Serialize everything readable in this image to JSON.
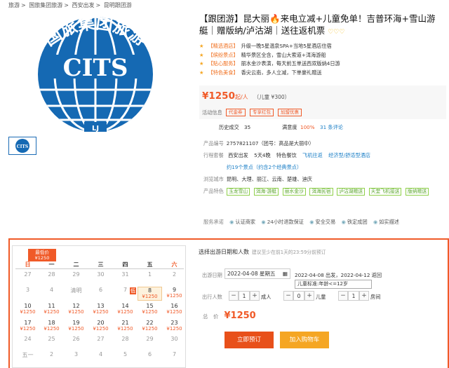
{
  "breadcrumb": [
    "旅游",
    "国旅集团旅游",
    "西安出发",
    "昆明跟团游"
  ],
  "logo": {
    "text_top": "国旅集团旅游",
    "text_center": "CITS",
    "text_bottom": "LJ"
  },
  "product": {
    "title": "【跟团游】昆大丽🔥来电立减+儿童免单！吉普环海+雪山游艇｜赠版纳/泸沽湖｜送往返机票",
    "hearts": "♡♡♡"
  },
  "features": [
    {
      "tag": "【精选酒店】",
      "text": "升级一晚5星温泉SPA+当地5星酒店住宿"
    },
    {
      "tag": "【缤纷景点】",
      "text": "精华景区全含，雪山大索道+洱海游船"
    },
    {
      "tag": "【贴心服务】",
      "text": "丽水金沙表演，每天前五单送西双版纳4日游"
    },
    {
      "tag": "【特色美食】",
      "text": "香尖云南，多人立减，下单豪礼赠送"
    }
  ],
  "price": {
    "amount": "¥1250",
    "unit": "起/人",
    "child": "（儿童 ¥300）",
    "promo_label": "活动信息",
    "promos": [
      "代金券",
      "专享红包",
      "加盟优惠"
    ]
  },
  "stats": {
    "sold_label": "历史成交",
    "sold_value": "35",
    "satisfaction_label": "满意度",
    "satisfaction_value": "100%",
    "reviews": "31 条评论"
  },
  "info": {
    "code_label": "产品编号",
    "code_value": "2757821107（团号：高品是大丽中）",
    "package_label": "行程套餐",
    "packages": [
      "西安出发",
      "5天4晚",
      "特色餐饮",
      "飞机往返",
      "经济型/舒适型酒店"
    ],
    "spots": "约19个景点（约含2个经典景点）",
    "cities_label": "浏览城市",
    "cities": "昆明、大理、丽江、云南、楚雄、迪庆",
    "features_label": "产品特色",
    "chips": [
      "玉龙雪山",
      "洱海·游艇",
      "丽水金沙",
      "洱海民宿",
      "泸沽湖赠送",
      "天堂飞机接送",
      "版纳赠送"
    ],
    "service_label": "服务承诺",
    "services": [
      "认证商家",
      "24小时退款保证",
      "安全交易",
      "铁定成团",
      "如实描述"
    ]
  },
  "calendar": {
    "badge": "最低价 ¥1250",
    "weekdays": [
      "日",
      "一",
      "二",
      "三",
      "四",
      "五",
      "六"
    ],
    "rows": [
      [
        {
          "d": "27"
        },
        {
          "d": "28"
        },
        {
          "d": "29"
        },
        {
          "d": "30"
        },
        {
          "d": "31"
        },
        {
          "d": "1"
        },
        {
          "d": "2"
        }
      ],
      [
        {
          "d": "3"
        },
        {
          "d": "4"
        },
        {
          "d": "清明"
        },
        {
          "d": "6"
        },
        {
          "d": "7"
        },
        {
          "d": "8",
          "p": "¥1250",
          "mark": "低"
        },
        {
          "d": "9",
          "p": "¥1250"
        }
      ],
      [
        {
          "d": "10",
          "p": "¥1250"
        },
        {
          "d": "11",
          "p": "¥1250"
        },
        {
          "d": "12",
          "p": "¥1250"
        },
        {
          "d": "13",
          "p": "¥1250"
        },
        {
          "d": "14",
          "p": "¥1250"
        },
        {
          "d": "15",
          "p": "¥1250"
        },
        {
          "d": "16",
          "p": "¥1250"
        }
      ],
      [
        {
          "d": "17",
          "p": "¥1250"
        },
        {
          "d": "18",
          "p": "¥1250"
        },
        {
          "d": "19",
          "p": "¥1250"
        },
        {
          "d": "20",
          "p": "¥1250"
        },
        {
          "d": "21",
          "p": "¥1250"
        },
        {
          "d": "22",
          "p": "¥1250"
        },
        {
          "d": "23",
          "p": "¥1250"
        }
      ],
      [
        {
          "d": "24"
        },
        {
          "d": "25"
        },
        {
          "d": "26"
        },
        {
          "d": "27"
        },
        {
          "d": "28"
        },
        {
          "d": "29"
        },
        {
          "d": "30"
        }
      ],
      [
        {
          "d": "五一"
        },
        {
          "d": "2"
        },
        {
          "d": "3"
        },
        {
          "d": "4"
        },
        {
          "d": "5"
        },
        {
          "d": "6"
        },
        {
          "d": "7"
        }
      ]
    ]
  },
  "booking": {
    "title": "选择出游日期和人数",
    "hint": "建议至少在前1天的23:59分前预订",
    "date_label": "出游日期",
    "date_value": "2022-04-08 星期五",
    "date_range": "2022-04-08 出发，2022-04-12 返回",
    "people_label": "出行人数",
    "adults": "1",
    "adult_label": "成人",
    "children": "0",
    "child_label": "儿童",
    "rooms": "1",
    "room_label": "房间",
    "tooltip": "儿童标准:年龄<=12岁",
    "total_label": "总　价",
    "total_value": "¥1250",
    "book_button": "立即预订",
    "cart_button": "加入购物车"
  }
}
